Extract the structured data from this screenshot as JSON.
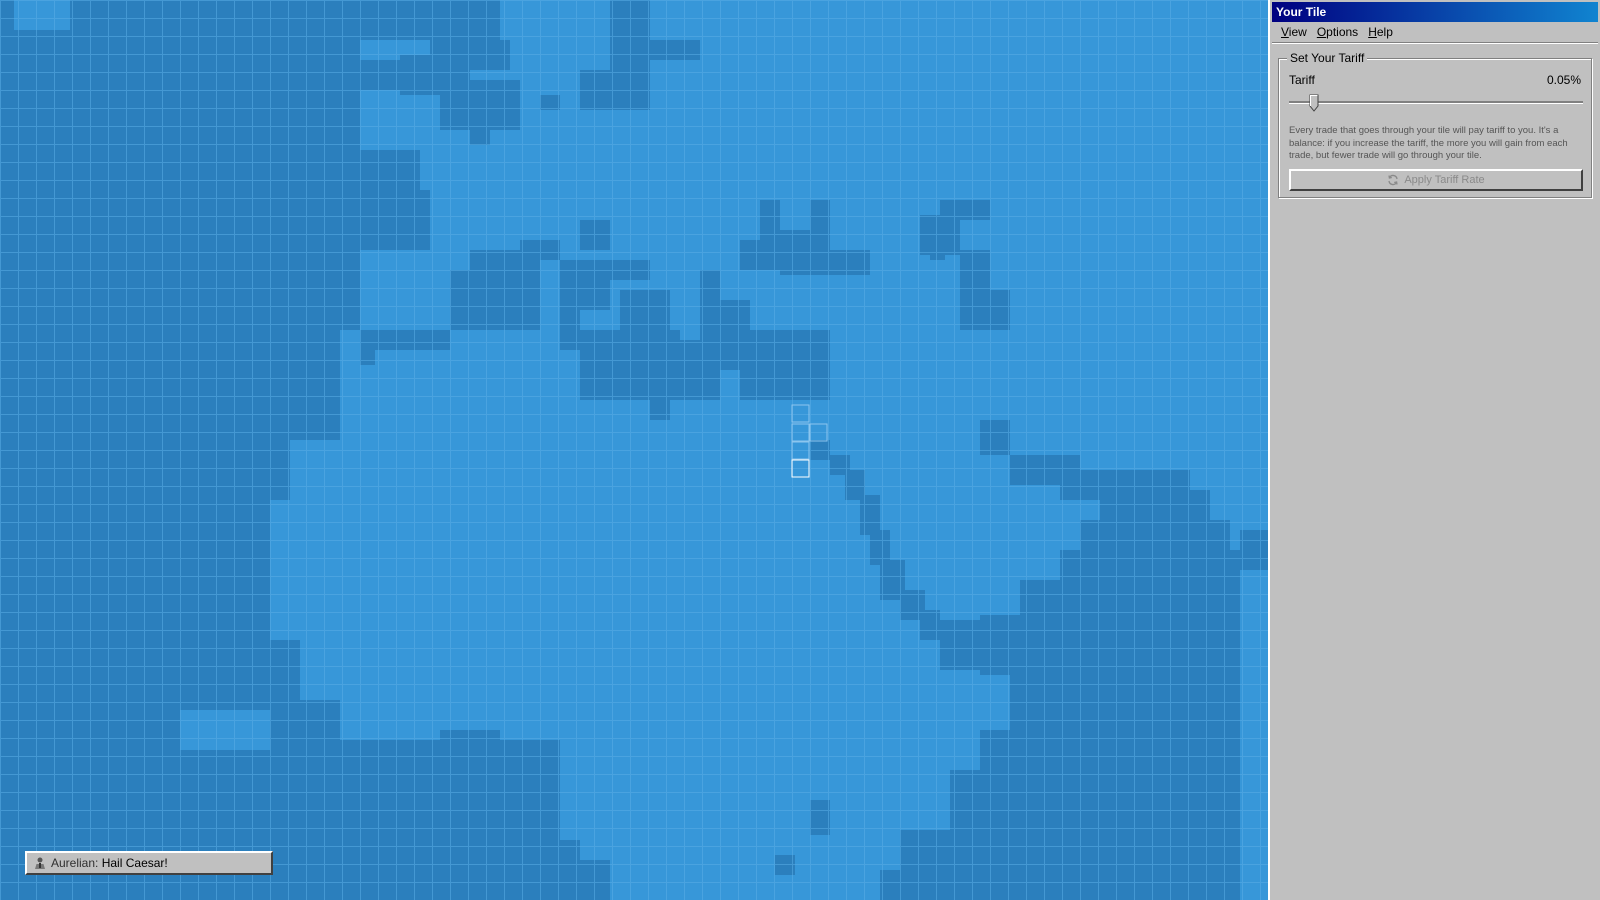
{
  "window": {
    "title": "Your Tile",
    "menu": [
      "View",
      "Options",
      "Help"
    ]
  },
  "tariff": {
    "group_label": "Set Your Tariff",
    "label": "Tariff",
    "value": "0.05%",
    "slider_fraction": 0.07,
    "description": "Every trade that goes through your tile will pay tariff to you. It's a balance: if you increase the tariff, the more you will gain from each trade, but fewer trade will go through your tile.",
    "apply_label": "Apply Tariff Rate",
    "apply_icon": "refresh-icon"
  },
  "chat": {
    "avatar_icon": "person-icon",
    "author": "Aurelian:",
    "message": "Hail Caesar!"
  },
  "colors": {
    "water": "#3797d9",
    "land": "#2b7fbd",
    "grid": "#5aaee6",
    "titlebar": "#000080"
  }
}
